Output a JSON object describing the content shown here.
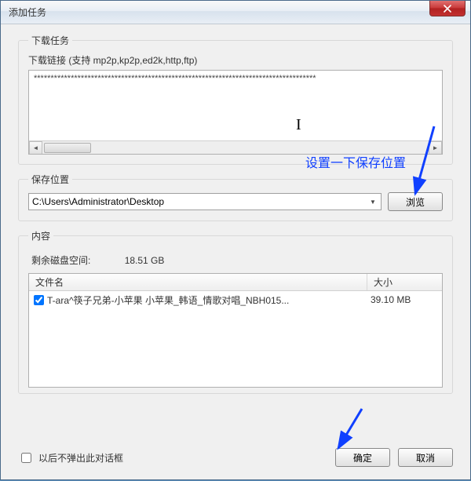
{
  "window": {
    "title": "添加任务"
  },
  "download": {
    "fieldset_title": "下载任务",
    "link_label": "下载链接 (支持 mp2p,kp2p,ed2k,http,ftp)",
    "link_value": "************************************************************************************"
  },
  "annotation": {
    "text": "设置一下保存位置"
  },
  "save": {
    "fieldset_title": "保存位置",
    "path": "C:\\Users\\Administrator\\Desktop",
    "browse_label": "浏览"
  },
  "content_section": {
    "fieldset_title": "内容",
    "disk_label": "剩余磁盘空间:",
    "disk_value": "18.51 GB",
    "columns": {
      "name": "文件名",
      "size": "大小"
    },
    "files": [
      {
        "checked": true,
        "name": "T-ara^筷子兄弟-小苹果 小苹果_韩语_情歌对唱_NBH015...",
        "size": "39.10 MB"
      }
    ]
  },
  "footer": {
    "checkbox_label": "以后不弹出此对话框",
    "ok_label": "确定",
    "cancel_label": "取消"
  }
}
